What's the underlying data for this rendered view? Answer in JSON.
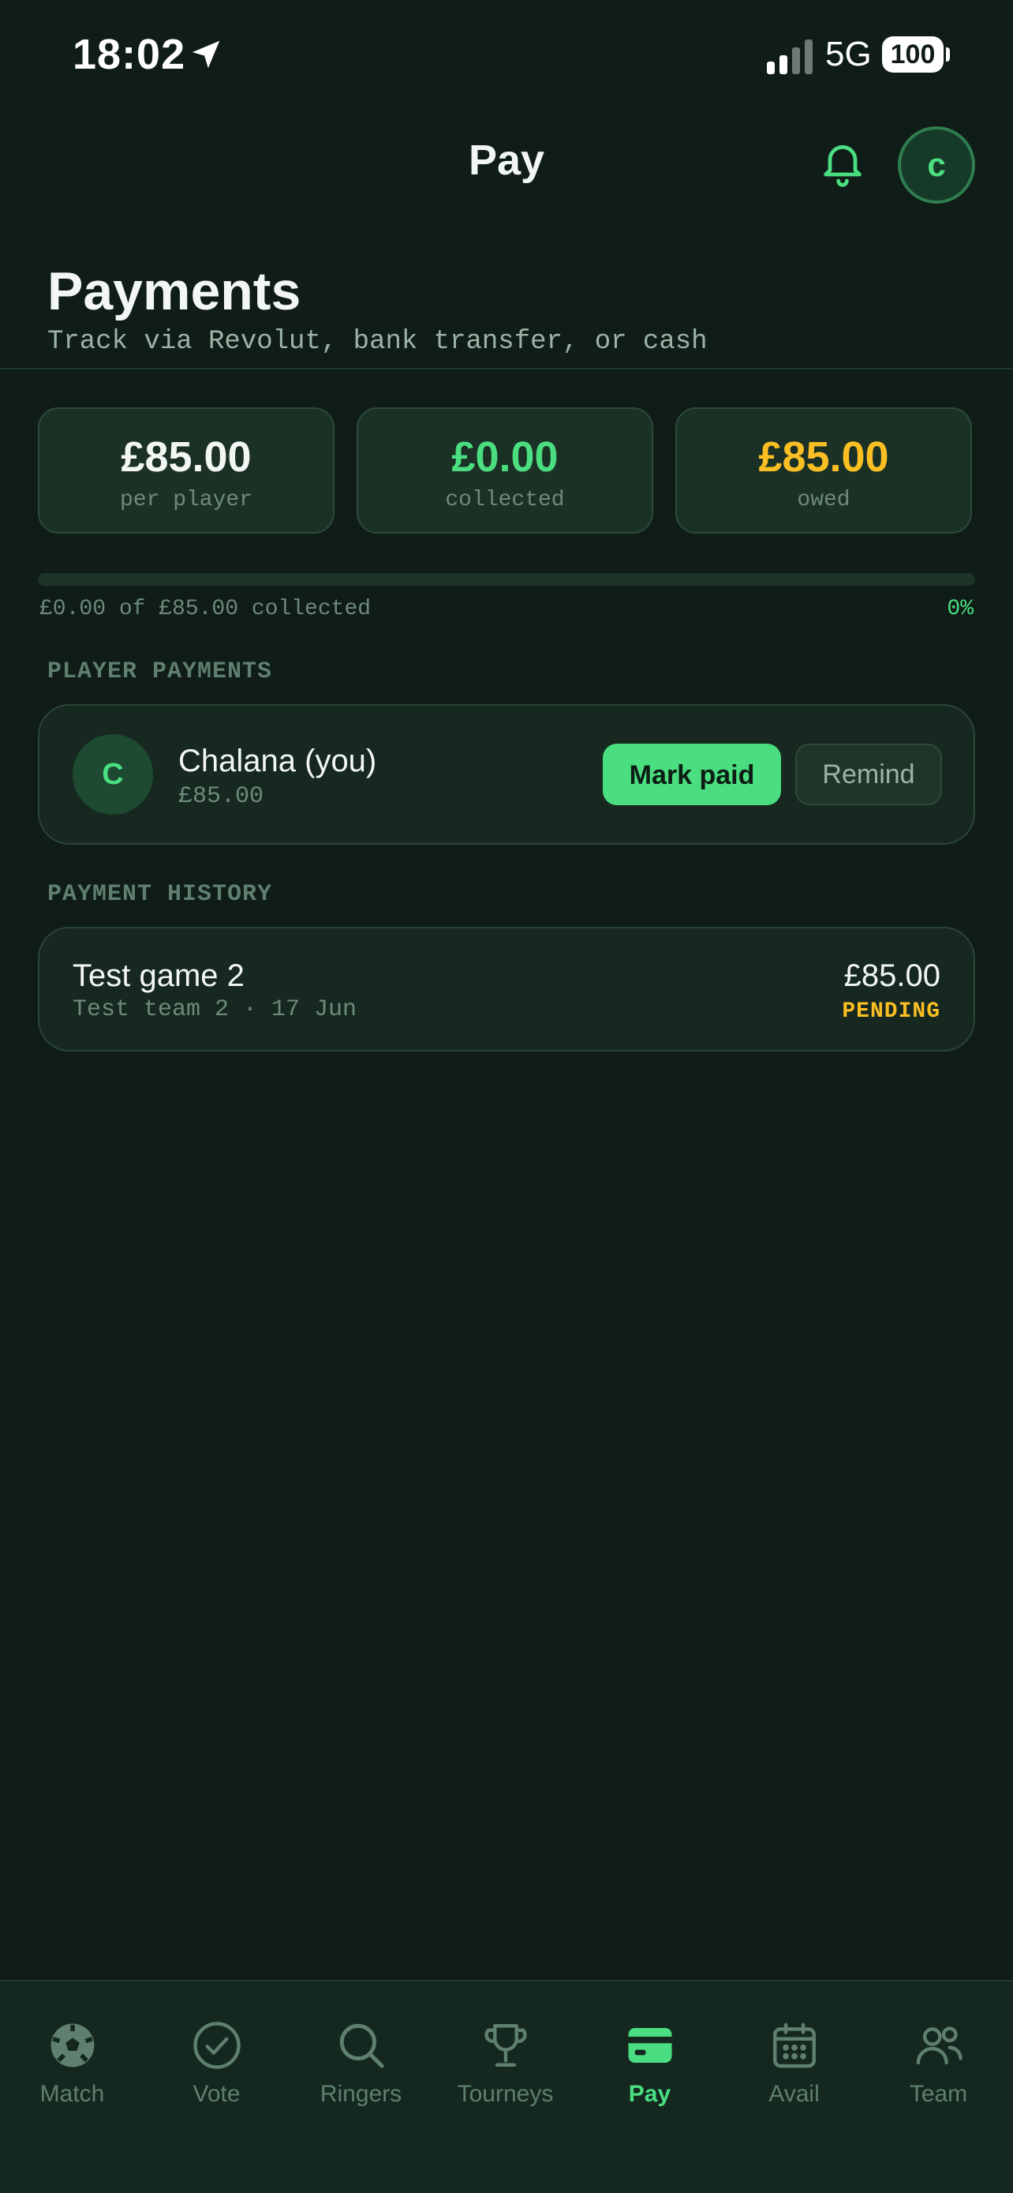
{
  "status_bar": {
    "time": "18:02",
    "network": "5G",
    "battery": "100",
    "icons": [
      "location-arrow-icon",
      "signal-icon"
    ]
  },
  "header": {
    "title": "Pay",
    "avatar_initial": "c",
    "icons": [
      "bell-icon"
    ]
  },
  "page": {
    "title": "Payments",
    "subtitle": "Track via Revolut, bank transfer, or cash"
  },
  "stats": [
    {
      "value": "£85.00",
      "label": "per player",
      "color": "#f2f7f4"
    },
    {
      "value": "£0.00",
      "label": "collected",
      "color": "#4ade80"
    },
    {
      "value": "£85.00",
      "label": "owed",
      "color": "#fbbf24"
    }
  ],
  "progress": {
    "text": "£0.00 of £85.00 collected",
    "percent_label": "0%",
    "fraction": 0
  },
  "player_payments": {
    "section_label": "PLAYER PAYMENTS",
    "items": [
      {
        "initial": "C",
        "name": "Chalana (you)",
        "amount": "£85.00",
        "mark_paid_label": "Mark paid",
        "remind_label": "Remind"
      }
    ]
  },
  "payment_history": {
    "section_label": "PAYMENT HISTORY",
    "items": [
      {
        "title": "Test game 2",
        "subtitle": "Test team 2 · 17 Jun",
        "amount": "£85.00",
        "status": "PENDING",
        "status_color": "#fbbf24"
      }
    ]
  },
  "bottom_nav": {
    "items": [
      {
        "label": "Match",
        "icon": "soccer-ball-icon"
      },
      {
        "label": "Vote",
        "icon": "check-circle-icon"
      },
      {
        "label": "Ringers",
        "icon": "search-icon"
      },
      {
        "label": "Tourneys",
        "icon": "trophy-icon"
      },
      {
        "label": "Pay",
        "icon": "credit-card-icon",
        "active": true
      },
      {
        "label": "Avail",
        "icon": "calendar-icon"
      },
      {
        "label": "Team",
        "icon": "users-icon"
      }
    ]
  },
  "colors": {
    "accent": "#4ade80",
    "warning": "#fbbf24",
    "background": "#0f1c17"
  }
}
